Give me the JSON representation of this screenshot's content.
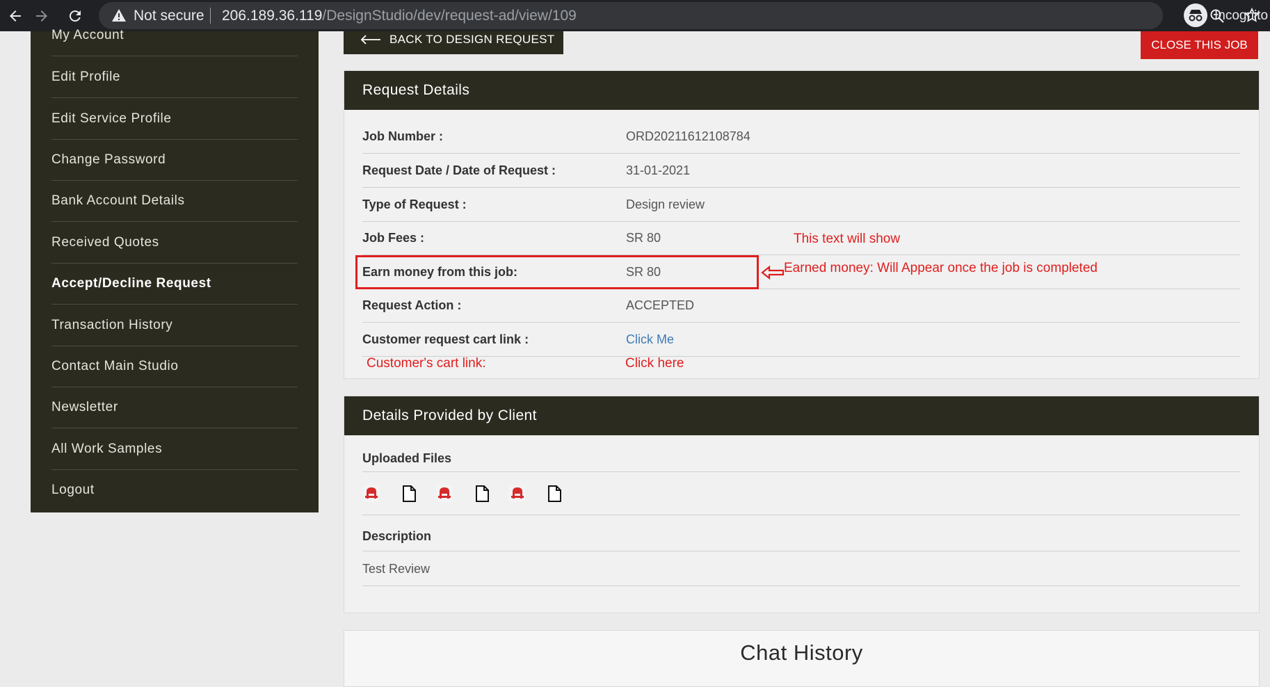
{
  "browser": {
    "not_secure": "Not secure",
    "url_host": "206.189.36.119",
    "url_path": "/DesignStudio/dev/request-ad/view/109",
    "incognito": "Incognito"
  },
  "sidebar": {
    "items": [
      {
        "label": "My Account"
      },
      {
        "label": "Edit Profile"
      },
      {
        "label": "Edit Service Profile"
      },
      {
        "label": "Change Password"
      },
      {
        "label": "Bank Account Details"
      },
      {
        "label": "Received Quotes"
      },
      {
        "label": "Accept/Decline Request",
        "active": true
      },
      {
        "label": "Transaction History"
      },
      {
        "label": "Contact Main Studio"
      },
      {
        "label": "Newsletter"
      },
      {
        "label": "All Work Samples"
      },
      {
        "label": "Logout"
      }
    ]
  },
  "actions": {
    "back": "BACK TO DESIGN REQUEST",
    "close": "CLOSE THIS JOB"
  },
  "request_details": {
    "title": "Request Details",
    "rows": [
      {
        "label": "Job Number :",
        "value": "ORD20211612108784"
      },
      {
        "label": "Request Date / Date of Request :",
        "value": "31-01-2021"
      },
      {
        "label": "Type of Request :",
        "value": "Design review"
      },
      {
        "label": "Job Fees :",
        "value": "SR 80"
      },
      {
        "label": "Earn money from this job:",
        "value": "SR 80"
      },
      {
        "label": "Request Action :",
        "value": "ACCEPTED"
      },
      {
        "label": "Customer request cart link :",
        "value": "Click Me"
      }
    ]
  },
  "annotations": {
    "text_will_show": "This text will show",
    "earned_money": "Earned money: Will Appear once the job is completed",
    "cart_link_label": "Customer's cart link:",
    "cart_link_value": "Click here",
    "highlight_color": "#e01e1e"
  },
  "client_details": {
    "title": "Details Provided by Client",
    "uploaded_files_label": "Uploaded Files",
    "files": [
      "pdf-icon",
      "file-icon",
      "pdf-icon",
      "file-icon",
      "pdf-icon",
      "file-icon"
    ],
    "description_label": "Description",
    "description_text": "Test Review"
  },
  "chat": {
    "title": "Chat History"
  },
  "colors": {
    "dark_panel": "#2b2b1f",
    "close_button": "#d01d1d",
    "link": "#3e7bb3"
  }
}
